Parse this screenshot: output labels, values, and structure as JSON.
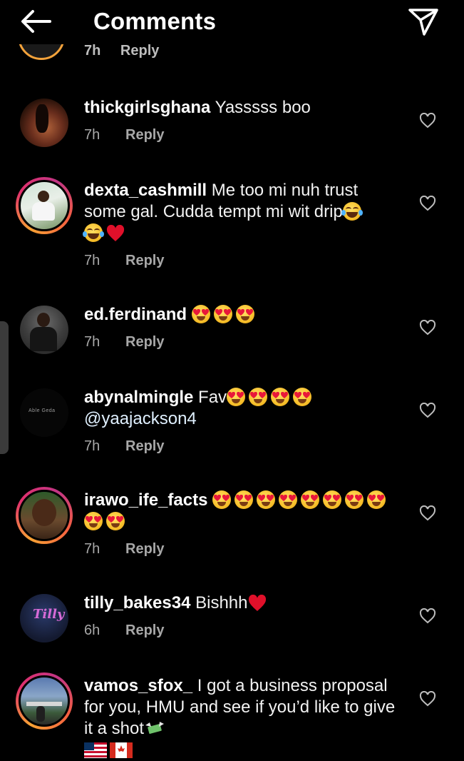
{
  "header": {
    "title": "Comments",
    "back_icon": "arrow-left-icon",
    "share_icon": "paper-plane-icon"
  },
  "partial_comment": {
    "time": "7h",
    "reply_label": "Reply"
  },
  "comments": [
    {
      "username": "thickgirlsghana",
      "text": "Yasssss boo",
      "time": "7h",
      "reply_label": "Reply"
    },
    {
      "username": "dexta_cashmill",
      "text": "Me too mi nuh trust some gal. Cudda tempt mi wit drip",
      "time": "7h",
      "reply_label": "Reply"
    },
    {
      "username": "ed.ferdinand",
      "text": "",
      "time": "7h",
      "reply_label": "Reply"
    },
    {
      "username": "abynalmingle",
      "text": "Fav",
      "mention": "@yaajackson4",
      "avatar_text": "Able Geda",
      "time": "7h",
      "reply_label": "Reply"
    },
    {
      "username": "irawo_ife_facts",
      "text": "",
      "time": "7h",
      "reply_label": "Reply"
    },
    {
      "username": "tilly_bakes34",
      "text": "Bishhh",
      "avatar_text": "Tilly",
      "time": "6h",
      "reply_label": "Reply"
    },
    {
      "username": "vamos_sfox_",
      "text": "I got a business proposal for you, HMU and see if you’d like to give it a shot"
    }
  ],
  "colors": {
    "background": "#000000",
    "text": "#ffffff",
    "meta": "#a8a8a8",
    "story_ring_start": "#f7a234",
    "story_ring_end": "#e1306c",
    "heart_red": "#e0102a"
  }
}
